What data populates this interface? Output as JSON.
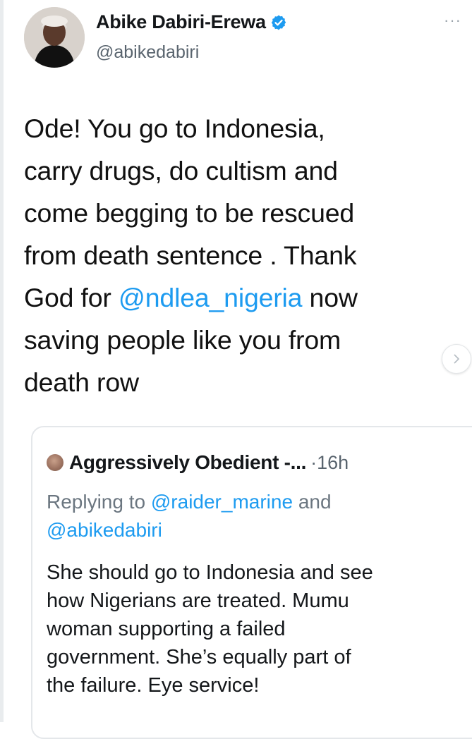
{
  "tweet": {
    "author_name": "Abike Dabiri-Erewa",
    "author_handle": "@abikedabiri",
    "more_label": "···",
    "body_lines": [
      {
        "text": "Ode! You go to Indonesia,"
      },
      {
        "text": "carry drugs, do cultism and"
      },
      {
        "text": "come begging to be rescued"
      },
      {
        "text": "from death sentence . Thank"
      },
      {
        "before": "God for ",
        "mention": "@ndlea_nigeria",
        "after": " now"
      },
      {
        "text": "saving people like you from"
      },
      {
        "text": "death row"
      }
    ]
  },
  "quote": {
    "author_name": "Aggressively Obedient -...",
    "time": "·16h",
    "replying_prefix": "Replying to ",
    "replying_mention_1": "@raider_marine",
    "replying_and": " and",
    "replying_mention_2": "@abikedabiri",
    "body_lines": [
      "She should go to Indonesia and see",
      "how Nigerians are treated. Mumu",
      "woman supporting a failed",
      "government. She’s equally part of",
      "the failure. Eye service!"
    ]
  },
  "icons": {
    "verified": "verified-badge-icon",
    "next": "chevron-right-icon"
  },
  "colors": {
    "mention": "#1d9bf0",
    "secondary_text": "#59646e",
    "verified": "#1d9bf0"
  }
}
